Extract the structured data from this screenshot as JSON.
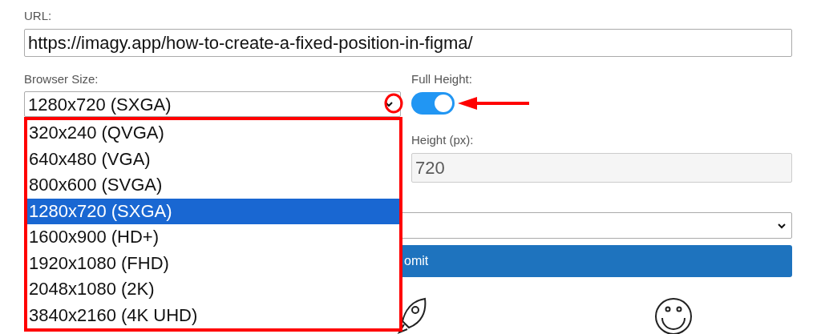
{
  "url": {
    "label": "URL:",
    "value": "https://imagy.app/how-to-create-a-fixed-position-in-figma/"
  },
  "browser_size": {
    "label": "Browser Size:",
    "value": "1280x720 (SXGA)",
    "expanded": true,
    "options": [
      {
        "label": "320x240 (QVGA)",
        "selected": false
      },
      {
        "label": "640x480 (VGA)",
        "selected": false
      },
      {
        "label": "800x600 (SVGA)",
        "selected": false
      },
      {
        "label": "1280x720 (SXGA)",
        "selected": true
      },
      {
        "label": "1600x900 (HD+)",
        "selected": false
      },
      {
        "label": "1920x1080 (FHD)",
        "selected": false
      },
      {
        "label": "2048x1080 (2K)",
        "selected": false
      },
      {
        "label": "3840x2160 (4K UHD)",
        "selected": false
      }
    ]
  },
  "full_height": {
    "label": "Full Height:",
    "on": true
  },
  "height": {
    "label": "Height (px):",
    "value": "720",
    "disabled": true
  },
  "submit": {
    "label": "omit"
  }
}
